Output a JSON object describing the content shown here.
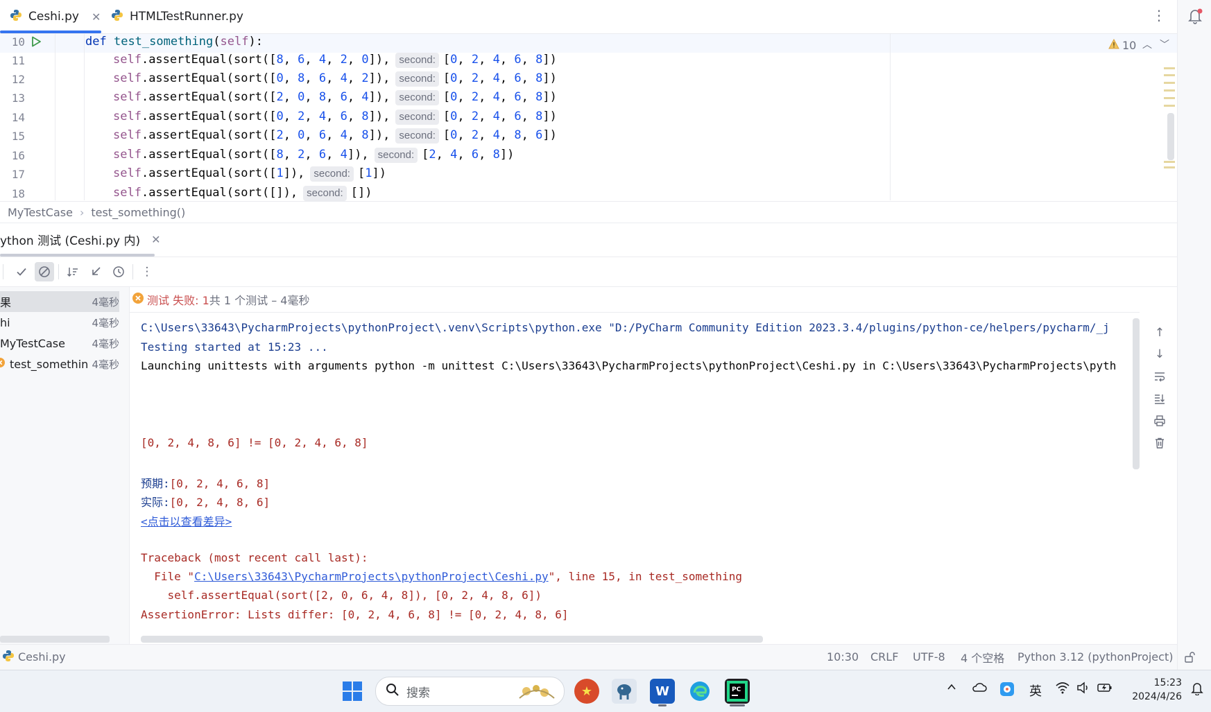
{
  "tabs": [
    {
      "label": "Ceshi.py",
      "close": "✕"
    },
    {
      "label": "HTMLTestRunner.py"
    }
  ],
  "tabbar_menu": "⋮",
  "editor": {
    "lines": [
      {
        "num": "10",
        "call": "",
        "arg": "",
        "hint": "",
        "expected": ""
      },
      {
        "num": "11",
        "call": "self.assertEqual(sort(",
        "arg": "[8, 6, 4, 2, 0]",
        "hint": "second:",
        "expected": "[0, 2, 4, 6, 8]"
      },
      {
        "num": "12",
        "call": "self.assertEqual(sort(",
        "arg": "[0, 8, 6, 4, 2]",
        "hint": "second:",
        "expected": "[0, 2, 4, 6, 8]"
      },
      {
        "num": "13",
        "call": "self.assertEqual(sort(",
        "arg": "[2, 0, 8, 6, 4]",
        "hint": "second:",
        "expected": "[0, 2, 4, 6, 8]"
      },
      {
        "num": "14",
        "call": "self.assertEqual(sort(",
        "arg": "[0, 2, 4, 6, 8]",
        "hint": "second:",
        "expected": "[0, 2, 4, 6, 8]"
      },
      {
        "num": "15",
        "call": "self.assertEqual(sort(",
        "arg": "[2, 0, 6, 4, 8]",
        "hint": "second:",
        "expected": "[0, 2, 4, 8, 6]"
      },
      {
        "num": "16",
        "call": "self.assertEqual(sort(",
        "arg": "[8, 2, 6, 4]",
        "hint": "second:",
        "expected": "[2, 4, 6, 8]"
      },
      {
        "num": "17",
        "call": "self.assertEqual(sort(",
        "arg": "[1]",
        "hint": "second:",
        "expected": "[1]"
      },
      {
        "num": "18",
        "call": "self.assertEqual(sort(",
        "arg": "[]",
        "hint": "second:",
        "expected": "[]"
      }
    ],
    "def_kw": "def",
    "def_name": "test_something",
    "def_self": "self",
    "warning_count": "10"
  },
  "breadcrumb": [
    "MyTestCase",
    "test_something()"
  ],
  "run": {
    "tab_label": "ython 测试 (Ceshi.py 内)",
    "tab_close": "✕",
    "status_fail": "测试 失败: 1",
    "status_rest": "共 1 个测试 – 4毫秒",
    "tree": [
      {
        "label": "果",
        "time": "4毫秒"
      },
      {
        "label": "hi",
        "time": "4毫秒"
      },
      {
        "label": "MyTestCase",
        "time": "4毫秒"
      },
      {
        "label": "test_somethin",
        "time": "4毫秒"
      }
    ],
    "console": {
      "cmd": "C:\\Users\\33643\\PycharmProjects\\pythonProject\\.venv\\Scripts\\python.exe \"D:/PyCharm Community Edition 2023.3.4/plugins/python-ce/helpers/pycharm/_j",
      "started": "Testing started at 15:23 ...",
      "launching": "Launching unittests with arguments python -m unittest C:\\Users\\33643\\PycharmProjects\\pythonProject\\Ceshi.py in C:\\Users\\33643\\PycharmProjects\\pyth",
      "diff": "[0, 2, 4, 8, 6] != [0, 2, 4, 6, 8]",
      "expected_label": "预期:",
      "expected_value": "[0, 2, 4, 6, 8]",
      "actual_label": "实际:",
      "actual_value": "[0, 2, 4, 8, 6]",
      "diff_link": "<点击以查看差异>",
      "traceback": "Traceback (most recent call last):",
      "file_prefix": "  File \"",
      "file_link": "C:\\Users\\33643\\PycharmProjects\\pythonProject\\Ceshi.py",
      "file_suffix": "\", line 15, in test_something",
      "code_line": "    self.assertEqual(sort([2, 0, 6, 4, 8]), [0, 2, 4, 8, 6])",
      "error": "AssertionError: Lists differ: [0, 2, 4, 6, 8] != [0, 2, 4, 8, 6]"
    }
  },
  "statusbar": {
    "file": "Ceshi.py",
    "position": "10:30",
    "line_sep": "CRLF",
    "encoding": "UTF-8",
    "indent": "4 个空格",
    "interpreter": "Python 3.12 (pythonProject)"
  },
  "taskbar": {
    "search_placeholder": "搜索",
    "time": "15:23",
    "date": "2024/4/26",
    "ime": "英"
  }
}
